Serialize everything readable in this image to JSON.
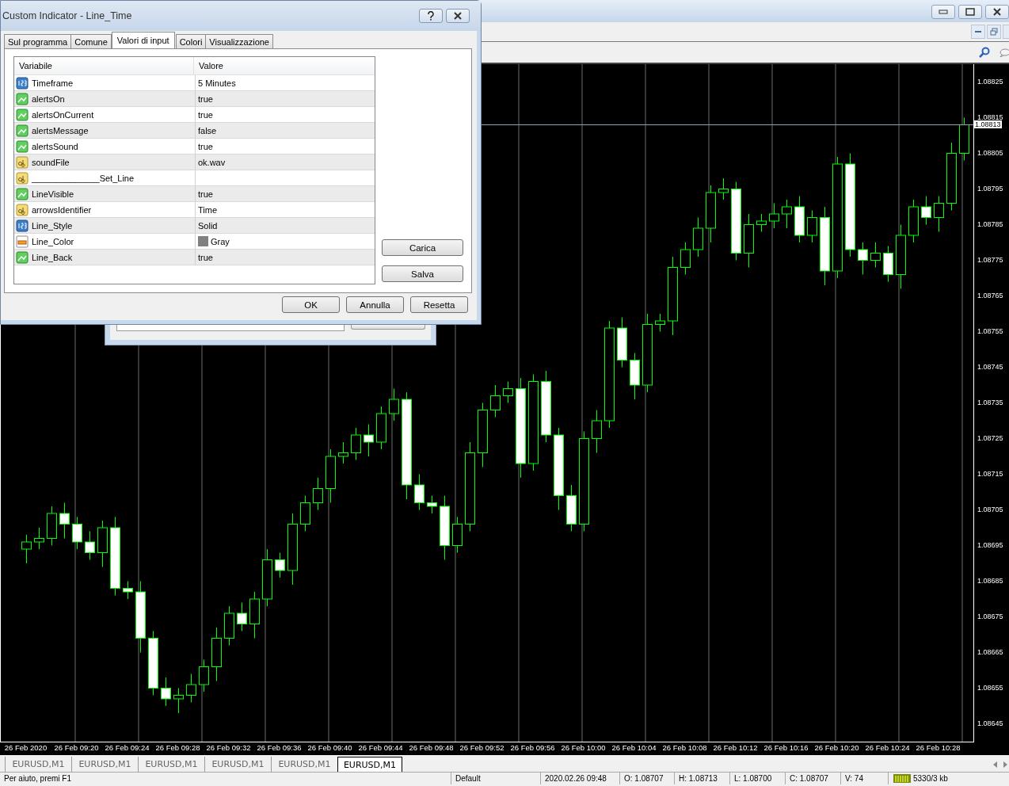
{
  "dialog": {
    "title": "Custom Indicator - Line_Time",
    "tabs": [
      {
        "label": "Sul programma",
        "selected": false
      },
      {
        "label": "Comune",
        "selected": false
      },
      {
        "label": "Valori di input",
        "selected": true
      },
      {
        "label": "Colori",
        "selected": false
      },
      {
        "label": "Visualizzazione",
        "selected": false
      }
    ],
    "table": {
      "columns": [
        "Variabile",
        "Valore"
      ],
      "rows": [
        {
          "kind": "number",
          "name": "Timeframe",
          "value": "5 Minutes"
        },
        {
          "kind": "bool",
          "name": "alertsOn",
          "value": "true"
        },
        {
          "kind": "bool",
          "name": "alertsOnCurrent",
          "value": "true"
        },
        {
          "kind": "bool",
          "name": "alertsMessage",
          "value": "false"
        },
        {
          "kind": "bool",
          "name": "alertsSound",
          "value": "true"
        },
        {
          "kind": "text",
          "name": "soundFile",
          "value": "ok.wav"
        },
        {
          "kind": "text",
          "name": "______________Set_Line"
        },
        {
          "kind": "bool",
          "name": "LineVisible",
          "value": "true"
        },
        {
          "kind": "text",
          "name": "arrowsIdentifier",
          "value": "Time"
        },
        {
          "kind": "number",
          "name": "Line_Style",
          "value": "Solid"
        },
        {
          "kind": "color",
          "name": "Line_Color",
          "value": "Gray",
          "color": "#808080"
        },
        {
          "kind": "bool",
          "name": "Line_Back",
          "value": "true"
        }
      ]
    },
    "side_buttons": [
      "Carica",
      "Salva"
    ],
    "buttons": [
      "OK",
      "Annulla",
      "Resetta"
    ]
  },
  "chart": {
    "current_price": "1.08813",
    "chart_data": {
      "type": "candlestick",
      "categories": [
        "26 Feb 2020",
        null,
        null,
        null,
        "26 Feb 09:20",
        null,
        null,
        null,
        "26 Feb 09:24",
        null,
        null,
        null,
        "26 Feb 09:28",
        null,
        null,
        null,
        "26 Feb 09:32",
        null,
        null,
        null,
        "26 Feb 09:36",
        null,
        null,
        null,
        "26 Feb 09:40",
        null,
        null,
        null,
        "26 Feb 09:44",
        null,
        null,
        null,
        "26 Feb 09:48",
        null,
        null,
        null,
        "26 Feb 09:52",
        null,
        null,
        null,
        "26 Feb 09:56",
        null,
        null,
        null,
        "26 Feb 10:00",
        null,
        null,
        null,
        "26 Feb 10:04",
        null,
        null,
        null,
        "26 Feb 10:08",
        null,
        null,
        null,
        "26 Feb 10:12",
        null,
        null,
        null,
        "26 Feb 10:16",
        null,
        null,
        null,
        "26 Feb 10:20",
        null,
        null,
        null,
        "26 Feb 10:24",
        null,
        null,
        null,
        "26 Feb 10:28",
        null,
        null
      ],
      "ylim": [
        1.0864,
        1.0883
      ],
      "ref_lines": [
        {
          "axis": "y",
          "value": 1.08813
        }
      ],
      "ohlc": [
        [
          1.08694,
          1.08698,
          1.0869,
          1.08696
        ],
        [
          1.08696,
          1.087,
          1.08694,
          1.08697
        ],
        [
          1.08697,
          1.08706,
          1.08695,
          1.08704
        ],
        [
          1.08704,
          1.08707,
          1.08697,
          1.08701
        ],
        [
          1.08701,
          1.08703,
          1.08694,
          1.08696
        ],
        [
          1.08696,
          1.08699,
          1.08691,
          1.08693
        ],
        [
          1.08693,
          1.08702,
          1.08689,
          1.087
        ],
        [
          1.087,
          1.08703,
          1.08681,
          1.08683
        ],
        [
          1.08683,
          1.08685,
          1.0868,
          1.08682
        ],
        [
          1.08682,
          1.08685,
          1.08665,
          1.08669
        ],
        [
          1.08669,
          1.08671,
          1.08653,
          1.08655
        ],
        [
          1.08655,
          1.08658,
          1.0865,
          1.08652
        ],
        [
          1.08652,
          1.08655,
          1.08648,
          1.08653
        ],
        [
          1.08653,
          1.08659,
          1.08651,
          1.08656
        ],
        [
          1.08656,
          1.08663,
          1.08654,
          1.08661
        ],
        [
          1.08661,
          1.08672,
          1.08657,
          1.08669
        ],
        [
          1.08669,
          1.08678,
          1.08667,
          1.08676
        ],
        [
          1.08676,
          1.08679,
          1.08671,
          1.08673
        ],
        [
          1.08673,
          1.08682,
          1.08669,
          1.0868
        ],
        [
          1.0868,
          1.08694,
          1.08678,
          1.08691
        ],
        [
          1.08691,
          1.08693,
          1.08686,
          1.08688
        ],
        [
          1.08688,
          1.08704,
          1.08684,
          1.08701
        ],
        [
          1.08701,
          1.08709,
          1.08699,
          1.08707
        ],
        [
          1.08707,
          1.08714,
          1.08705,
          1.08711
        ],
        [
          1.08711,
          1.08722,
          1.08707,
          1.0872
        ],
        [
          1.0872,
          1.08724,
          1.08718,
          1.08721
        ],
        [
          1.08721,
          1.08728,
          1.08719,
          1.08726
        ],
        [
          1.08726,
          1.08729,
          1.0872,
          1.08724
        ],
        [
          1.08724,
          1.08734,
          1.08722,
          1.08732
        ],
        [
          1.08732,
          1.08739,
          1.0873,
          1.08736
        ],
        [
          1.08736,
          1.08738,
          1.08708,
          1.08712
        ],
        [
          1.08712,
          1.08715,
          1.08705,
          1.08707
        ],
        [
          1.08707,
          1.08709,
          1.08704,
          1.08706
        ],
        [
          1.08706,
          1.08709,
          1.08691,
          1.08695
        ],
        [
          1.08695,
          1.08703,
          1.08693,
          1.08701
        ],
        [
          1.08701,
          1.08724,
          1.08699,
          1.08721
        ],
        [
          1.08721,
          1.08735,
          1.08717,
          1.08733
        ],
        [
          1.08733,
          1.0874,
          1.08731,
          1.08737
        ],
        [
          1.08737,
          1.08741,
          1.08735,
          1.08739
        ],
        [
          1.08739,
          1.08742,
          1.08714,
          1.08718
        ],
        [
          1.08718,
          1.08743,
          1.08716,
          1.08741
        ],
        [
          1.08741,
          1.08744,
          1.08724,
          1.08726
        ],
        [
          1.08726,
          1.08728,
          1.08705,
          1.08709
        ],
        [
          1.08709,
          1.08712,
          1.08699,
          1.08701
        ],
        [
          1.08701,
          1.08727,
          1.08699,
          1.08725
        ],
        [
          1.08725,
          1.08733,
          1.08721,
          1.0873
        ],
        [
          1.0873,
          1.08758,
          1.08728,
          1.08756
        ],
        [
          1.08756,
          1.08759,
          1.08745,
          1.08747
        ],
        [
          1.08747,
          1.08749,
          1.08736,
          1.0874
        ],
        [
          1.0874,
          1.0876,
          1.08738,
          1.08757
        ],
        [
          1.08757,
          1.0876,
          1.08755,
          1.08758
        ],
        [
          1.08758,
          1.08776,
          1.08754,
          1.08773
        ],
        [
          1.08773,
          1.0878,
          1.08771,
          1.08778
        ],
        [
          1.08778,
          1.08787,
          1.08776,
          1.08784
        ],
        [
          1.08784,
          1.08796,
          1.0878,
          1.08794
        ],
        [
          1.08794,
          1.08798,
          1.08792,
          1.08795
        ],
        [
          1.08795,
          1.08797,
          1.08775,
          1.08777
        ],
        [
          1.08777,
          1.08788,
          1.08773,
          1.08785
        ],
        [
          1.08785,
          1.08788,
          1.08783,
          1.08786
        ],
        [
          1.08786,
          1.08791,
          1.08784,
          1.08788
        ],
        [
          1.08788,
          1.08792,
          1.08784,
          1.0879
        ],
        [
          1.0879,
          1.08793,
          1.0878,
          1.08782
        ],
        [
          1.08782,
          1.08789,
          1.0878,
          1.08787
        ],
        [
          1.08787,
          1.0879,
          1.08768,
          1.08772
        ],
        [
          1.08772,
          1.08804,
          1.0877,
          1.08802
        ],
        [
          1.08802,
          1.08805,
          1.08776,
          1.08778
        ],
        [
          1.08778,
          1.0878,
          1.08771,
          1.08775
        ],
        [
          1.08775,
          1.0878,
          1.08773,
          1.08777
        ],
        [
          1.08777,
          1.08779,
          1.08769,
          1.08771
        ],
        [
          1.08771,
          1.08785,
          1.08767,
          1.08782
        ],
        [
          1.08782,
          1.08792,
          1.0878,
          1.0879
        ],
        [
          1.0879,
          1.08793,
          1.08785,
          1.08787
        ],
        [
          1.08787,
          1.08793,
          1.08783,
          1.08791
        ],
        [
          1.08791,
          1.08808,
          1.08789,
          1.08805
        ],
        [
          1.08805,
          1.08815,
          1.08803,
          1.08813
        ]
      ],
      "yticks": [
        1.08825,
        1.08815,
        1.08805,
        1.08795,
        1.08785,
        1.08775,
        1.08765,
        1.08755,
        1.08745,
        1.08735,
        1.08725,
        1.08715,
        1.08705,
        1.08695,
        1.08685,
        1.08675,
        1.08665,
        1.08655,
        1.08645
      ]
    }
  },
  "chart_tabs": [
    {
      "label": "EURUSD,M1",
      "selected": false
    },
    {
      "label": "EURUSD,M1",
      "selected": false
    },
    {
      "label": "EURUSD,M1",
      "selected": false
    },
    {
      "label": "EURUSD,M1",
      "selected": false
    },
    {
      "label": "EURUSD,M1",
      "selected": false
    },
    {
      "label": "EURUSD,M1",
      "selected": true
    }
  ],
  "status_bar": {
    "help": "Per aiuto, premi F1",
    "profile": "Default",
    "time": "2020.02.26 09:48",
    "open": "O: 1.08707",
    "high": "H: 1.08713",
    "low": "L: 1.08700",
    "close": "C: 1.08707",
    "volume": "V: 74",
    "traffic": "5330/3 kb"
  }
}
